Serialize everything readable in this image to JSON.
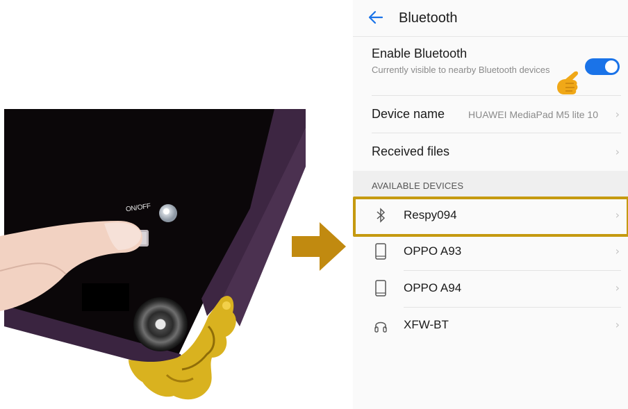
{
  "photo": {
    "switch_label": "ON/OFF"
  },
  "screen": {
    "title": "Bluetooth",
    "enable": {
      "label": "Enable Bluetooth",
      "subtitle": "Currently visible to nearby Bluetooth devices",
      "toggle_on": true
    },
    "device_name": {
      "label": "Device name",
      "value": "HUAWEI MediaPad M5 lite 10"
    },
    "received_files": {
      "label": "Received files"
    },
    "section_header": "AVAILABLE DEVICES",
    "devices": [
      {
        "name": "Respy094",
        "icon": "bluetooth-icon",
        "highlighted": true
      },
      {
        "name": "OPPO A93",
        "icon": "phone-icon",
        "highlighted": false
      },
      {
        "name": "OPPO A94",
        "icon": "phone-icon",
        "highlighted": false
      },
      {
        "name": "XFW-BT",
        "icon": "headset-icon",
        "highlighted": false
      }
    ],
    "colors": {
      "accent": "#1a73e8",
      "highlight_border": "#c59a10",
      "arrow": "#c18a10"
    }
  }
}
